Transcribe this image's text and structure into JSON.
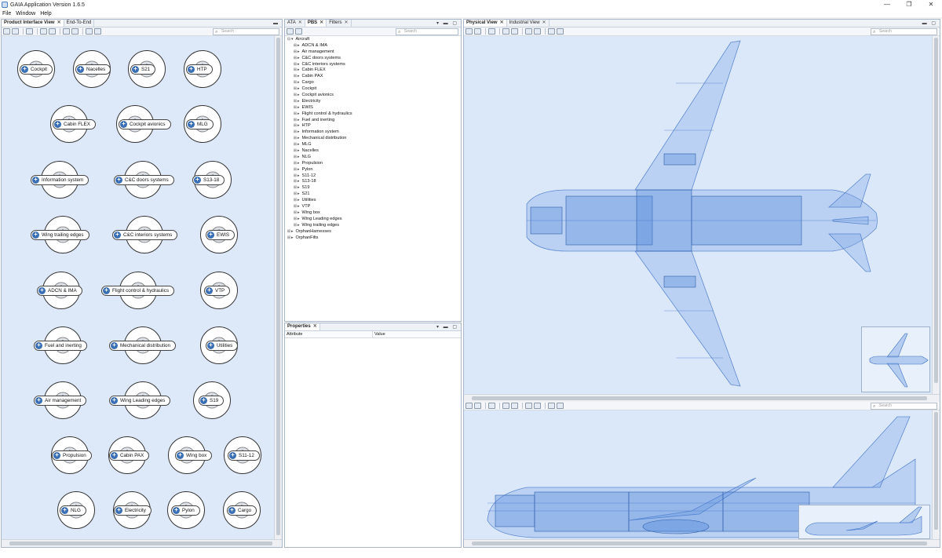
{
  "window": {
    "title": "GAIA Application Version 1.6.5",
    "controls": [
      "—",
      "❐",
      "✕"
    ]
  },
  "menu": [
    "File",
    "Window",
    "Help"
  ],
  "left_panel": {
    "tabs": [
      {
        "label": "Product Interface View",
        "active": true
      },
      {
        "label": "End-To-End",
        "active": false
      }
    ],
    "search_placeholder": "Search",
    "nodes": [
      {
        "label": "Cockpit"
      },
      {
        "label": "Nacelles"
      },
      {
        "label": "S21"
      },
      {
        "label": "HTP"
      },
      {
        "label": "Cabin FLEX"
      },
      {
        "label": "Cockpit avionics"
      },
      {
        "label": "MLG"
      },
      {
        "label": "Information system"
      },
      {
        "label": "C&C doors systems"
      },
      {
        "label": "S13-18"
      },
      {
        "label": "Wing trailing edges"
      },
      {
        "label": "C&C interiors systems"
      },
      {
        "label": "EWIS"
      },
      {
        "label": "ADCN & IMA"
      },
      {
        "label": "Flight control & hydraulics"
      },
      {
        "label": "VTP"
      },
      {
        "label": "Fuel and inerting"
      },
      {
        "label": "Mechanical distribution"
      },
      {
        "label": "Utilities"
      },
      {
        "label": "Air management"
      },
      {
        "label": "Wing Leading edges"
      },
      {
        "label": "S19"
      },
      {
        "label": "Propulsion"
      },
      {
        "label": "Cabin PAX"
      },
      {
        "label": "Wing box"
      },
      {
        "label": "S11-12"
      },
      {
        "label": "NLG"
      },
      {
        "label": "Electricity"
      },
      {
        "label": "Pylon"
      },
      {
        "label": "Cargo"
      }
    ]
  },
  "middle_panel": {
    "tabs": [
      {
        "label": "ATA",
        "active": false
      },
      {
        "label": "PBS",
        "active": true
      },
      {
        "label": "Filters",
        "active": false
      }
    ],
    "search_placeholder": "Search",
    "tree_root": "Aircraft",
    "tree_items": [
      "ADCN & IMA",
      "Air management",
      "C&C doors systems",
      "C&C interiors systems",
      "Cabin FLEX",
      "Cabin PAX",
      "Cargo",
      "Cockpit",
      "Cockpit avionics",
      "Electricity",
      "EWIS",
      "Flight control & hydraulics",
      "Fuel and inerting",
      "HTP",
      "Information system",
      "Mechanical distribution",
      "MLG",
      "Nacelles",
      "NLG",
      "Propulsion",
      "Pylon",
      "S11-12",
      "S13-18",
      "S19",
      "S21",
      "Utilities",
      "VTP",
      "Wing box",
      "Wing Leading edges",
      "Wing trailing edges"
    ],
    "tree_orphans": [
      "OrphanHarnesses",
      "OrphanFilts"
    ]
  },
  "properties_panel": {
    "tab": "Properties",
    "columns": [
      "Attribute",
      "Value"
    ]
  },
  "right_panel": {
    "tabs": [
      {
        "label": "Physical View",
        "active": true
      },
      {
        "label": "Industrial View",
        "active": false
      }
    ],
    "search_placeholder": "Search",
    "colors": {
      "fill": "#7ea7e6",
      "stroke": "#3d6fc2",
      "background": "#dbe8fa"
    }
  }
}
